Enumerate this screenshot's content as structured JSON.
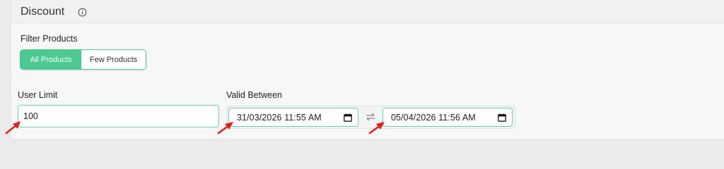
{
  "section": {
    "title": "Discount",
    "info_icon": "info-circle-icon"
  },
  "filter": {
    "label": "Filter Products",
    "options": [
      "All Products",
      "Few Products"
    ],
    "selected": "All Products",
    "accent_color": "#4cc98f"
  },
  "user_limit": {
    "label": "User Limit",
    "value": "100"
  },
  "valid_between": {
    "label": "Valid Between",
    "start": "31/03/2026 11:55 AM",
    "end": "05/04/2026 11:56 AM",
    "calendar_icon": "calendar-icon",
    "swap_icon": "swap-arrows-icon"
  },
  "annotations": {
    "arrow_color": "#e0201c",
    "arrow_icon": "red-pointer-arrow"
  }
}
